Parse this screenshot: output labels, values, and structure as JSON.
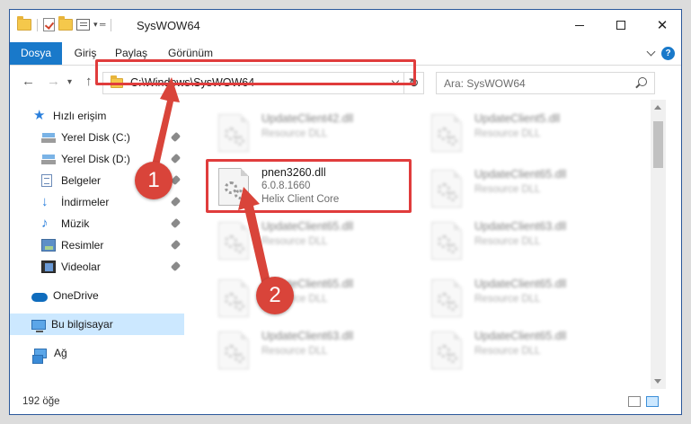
{
  "window": {
    "title": "SysWOW64"
  },
  "ribbon": {
    "tabs": [
      {
        "label": "Dosya",
        "active": true
      },
      {
        "label": "Giriş"
      },
      {
        "label": "Paylaş"
      },
      {
        "label": "Görünüm"
      }
    ],
    "help": "?"
  },
  "address": {
    "path": "C:\\Windows\\SysWOW64",
    "refresh_icon": "refresh-icon"
  },
  "search": {
    "placeholder": "Ara: SysWOW64"
  },
  "sidebar": {
    "quick_access": "Hızlı erişim",
    "items": [
      {
        "label": "Yerel Disk (C:)",
        "icon": "drive-icon"
      },
      {
        "label": "Yerel Disk (D:)",
        "icon": "drive-icon"
      },
      {
        "label": "Belgeler",
        "icon": "documents-icon"
      },
      {
        "label": "İndirmeler",
        "icon": "downloads-icon"
      },
      {
        "label": "Müzik",
        "icon": "music-icon"
      },
      {
        "label": "Resimler",
        "icon": "pictures-icon"
      },
      {
        "label": "Videolar",
        "icon": "videos-icon"
      }
    ],
    "onedrive": "OneDrive",
    "this_pc": "Bu bilgisayar",
    "network": "Ağ"
  },
  "files": {
    "highlighted": {
      "name": "pnen3260.dll",
      "version": "6.0.8.1660",
      "description": "Helix Client Core"
    },
    "background": [
      {
        "name": "UpdateClient42.dll",
        "desc": "Resource DLL"
      },
      {
        "name": "UpdateClient5.dll",
        "desc": "Resource DLL"
      },
      {
        "name": "UpdateClient65.dll",
        "desc": "Resource DLL"
      },
      {
        "name": "UpdateClient65.dll",
        "desc": "Resource DLL"
      },
      {
        "name": "UpdateClient63.dll",
        "desc": "Resource DLL"
      },
      {
        "name": "UpdateClient65.dll",
        "desc": "Resource DLL"
      },
      {
        "name": "UpdateClient65.dll",
        "desc": "Resource DLL"
      },
      {
        "name": "UpdateClient63.dll",
        "desc": "Resource DLL"
      },
      {
        "name": "UpdateClient65.dll",
        "desc": "Resource DLL"
      }
    ]
  },
  "status": {
    "item_count": "192 öğe"
  },
  "annotations": {
    "step1": "1",
    "step2": "2",
    "color": "#d9443a"
  },
  "colors": {
    "accent": "#1979ca",
    "highlight": "#e03c3c",
    "selection": "#cce8ff"
  }
}
